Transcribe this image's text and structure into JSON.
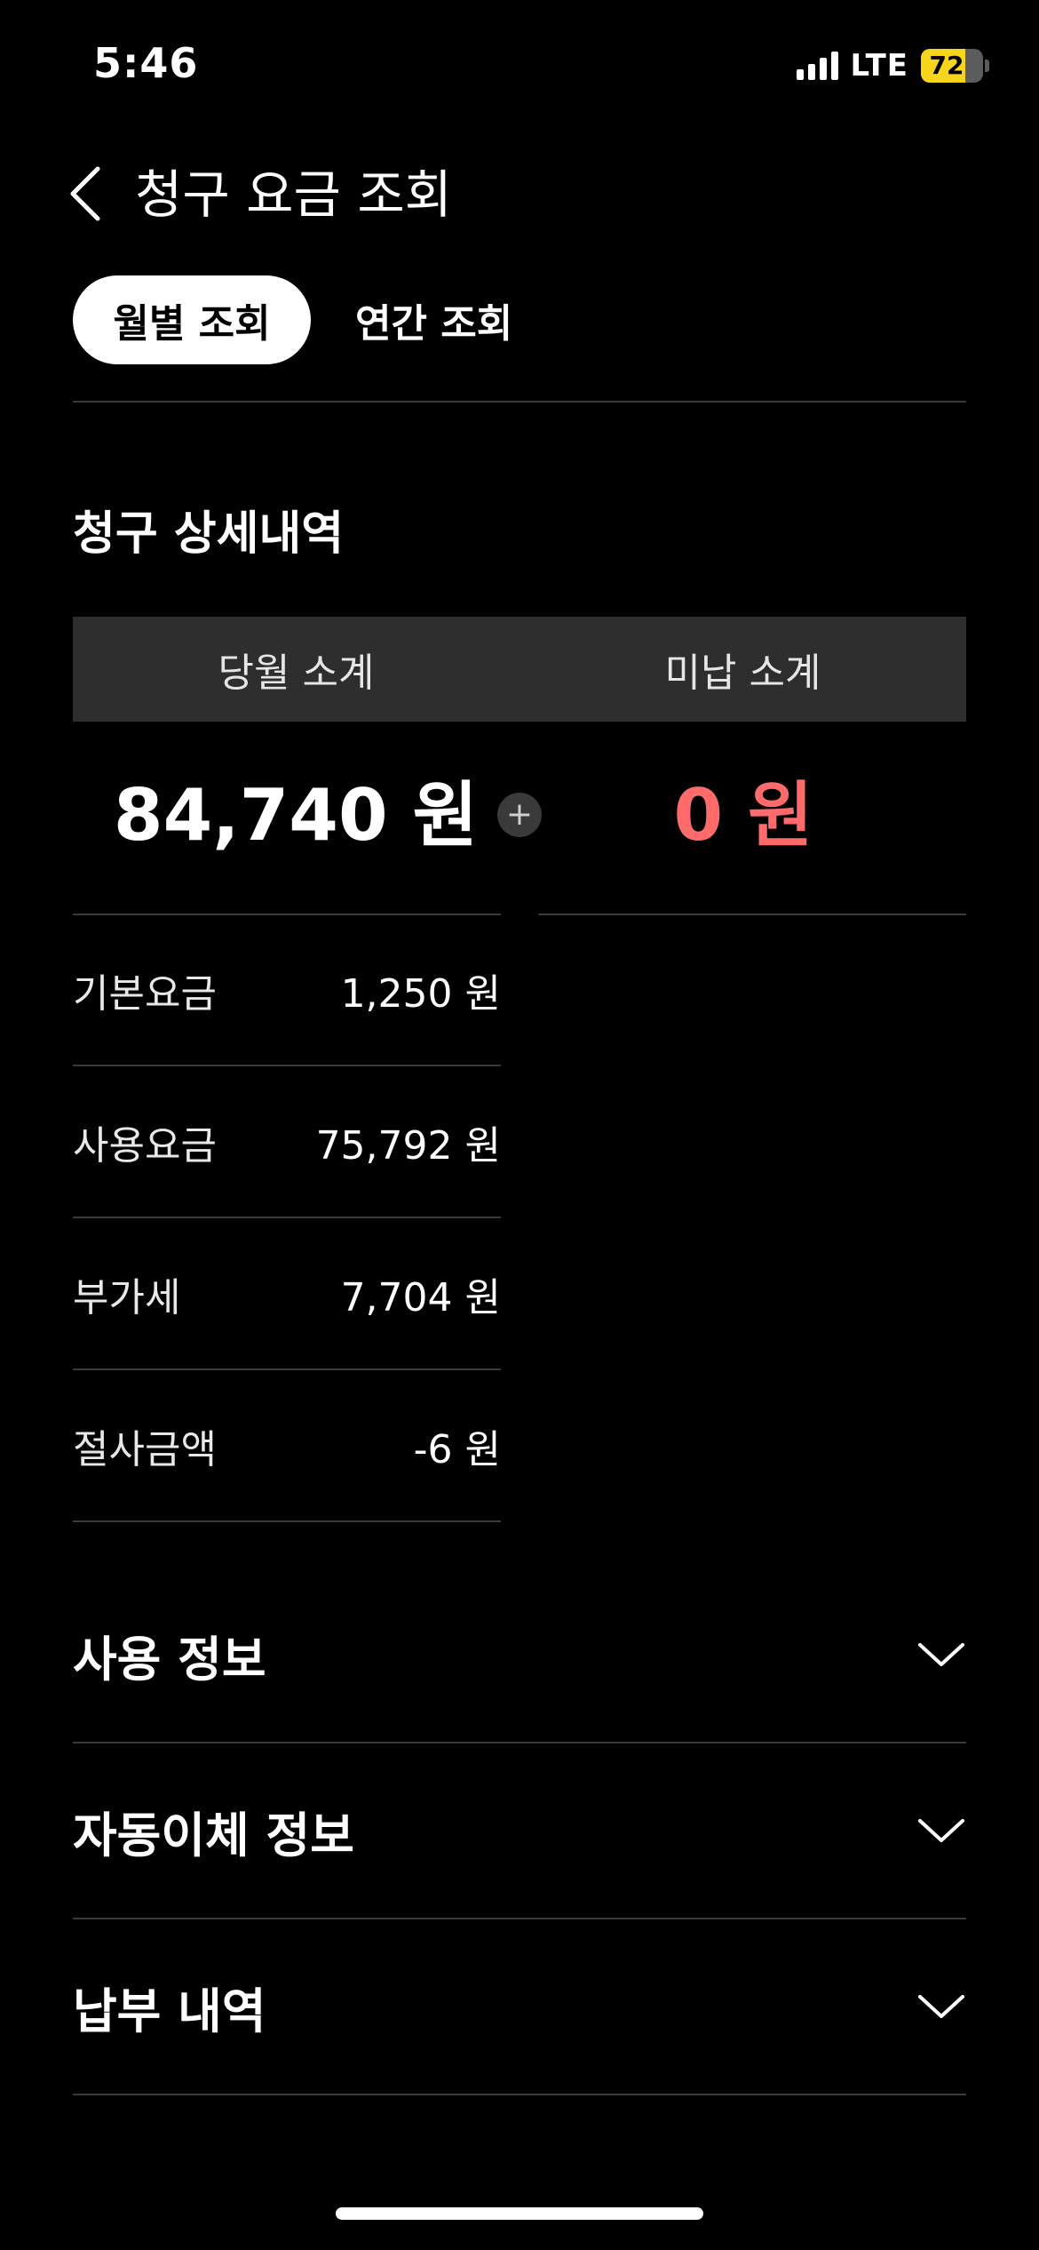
{
  "status_bar": {
    "time": "5:46",
    "network": "LTE",
    "battery": "72",
    "battery_level": 0.72
  },
  "header": {
    "title": "청구 요금 조회",
    "back_icon": "chevron-left-icon"
  },
  "tabs": [
    {
      "label": "월별 조회",
      "active": true
    },
    {
      "label": "연간 조회",
      "active": false
    }
  ],
  "billing": {
    "section_title": "청구 상세내역",
    "current_label": "당월 소계",
    "unpaid_label": "미납 소계",
    "current_total": "84,740 원",
    "plus_icon": "+",
    "unpaid_total": "0 원",
    "items": [
      {
        "label": "기본요금",
        "value": "1,250 원"
      },
      {
        "label": "사용요금",
        "value": "75,792 원"
      },
      {
        "label": "부가세",
        "value": "7,704 원"
      },
      {
        "label": "절사금액",
        "value": "-6 원"
      }
    ]
  },
  "accordions": [
    {
      "label": "사용 정보"
    },
    {
      "label": "자동이체 정보"
    },
    {
      "label": "납부 내역"
    }
  ],
  "colors": {
    "background": "#000000",
    "unpaid_accent": "#ff6b6b",
    "battery": "#f7d51c"
  }
}
